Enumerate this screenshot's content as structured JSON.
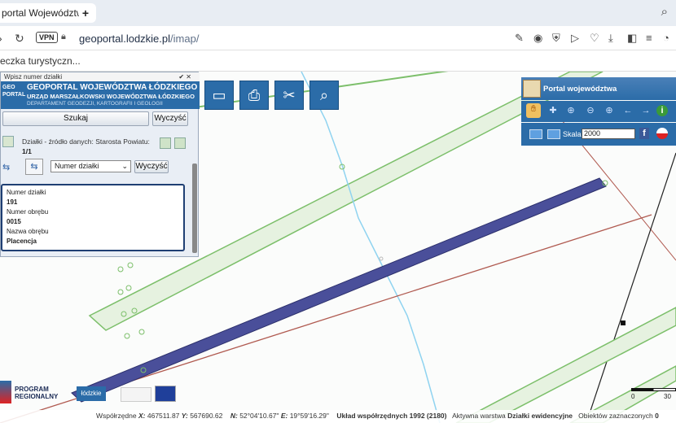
{
  "browser": {
    "tab_title": "portal Województwa Ł",
    "new_tab": "+",
    "vpn_label": "VPN",
    "url_domain": "geoportal.lodzkie.pl",
    "url_path": "/imap/",
    "bookmark": "eczka turystyczn..."
  },
  "panel": {
    "top_label": "Wpisz numer działki",
    "top_controls": "✔ ✕",
    "logo_text": "GEO PORTAL",
    "banner_title": "GEOPORTAL WOJEWÓDZTWA ŁÓDZKIEGO",
    "banner_sub1": "URZĄD MARSZAŁKOWSKI WOJEWÓDZTWA ŁÓDZKIEGO",
    "banner_sub2": "DEPARTAMENT GEODEZJI, KARTOGRAFII I GEOLOGII",
    "search_label": "Szukaj",
    "clear_label": "Wyczyść",
    "layer_text": "Działki - źródło danych: Starosta Powiatu:",
    "layer_count": "1/1",
    "select_value": "Numer działki",
    "clear2_label": "Wyczyść",
    "info": {
      "lbl1": "Numer działki",
      "val1": "191",
      "lbl2": "Numer obrębu",
      "val2": "0015",
      "lbl3": "Nazwa obrębu",
      "val3": "Placencja"
    }
  },
  "right_panel": {
    "title": "Portal województwa",
    "scale_label": "Skala:",
    "scale_value": "2000"
  },
  "footer": {
    "program_line1": "PROGRAM",
    "program_line2": "REGIONALNY",
    "lodzkie": "łódzkie",
    "scalebar_0": "0",
    "scalebar_30": "30"
  },
  "status": {
    "coords_label": "Współrzędne",
    "x_label": "X:",
    "x_val": "467511.87",
    "y_label": "Y:",
    "y_val": "567690.62",
    "n_label": "N:",
    "n_val": "52°04'10.67\"",
    "e_label": "E:",
    "e_val": "19°59'16.29\"",
    "system": "Układ współrzędnych 1992 (2180)",
    "active_label": "Aktywna warstwa",
    "active_layer": "Działki ewidencyjne",
    "selected_label": "Obiektów zaznaczonych",
    "selected_count": "0"
  },
  "colors": {
    "accent": "#2b6ca8",
    "parcel": "#4a4f9a",
    "green_line": "#7cbf6a",
    "red_line": "#b05a50",
    "blue_line": "#8fd3f0"
  }
}
